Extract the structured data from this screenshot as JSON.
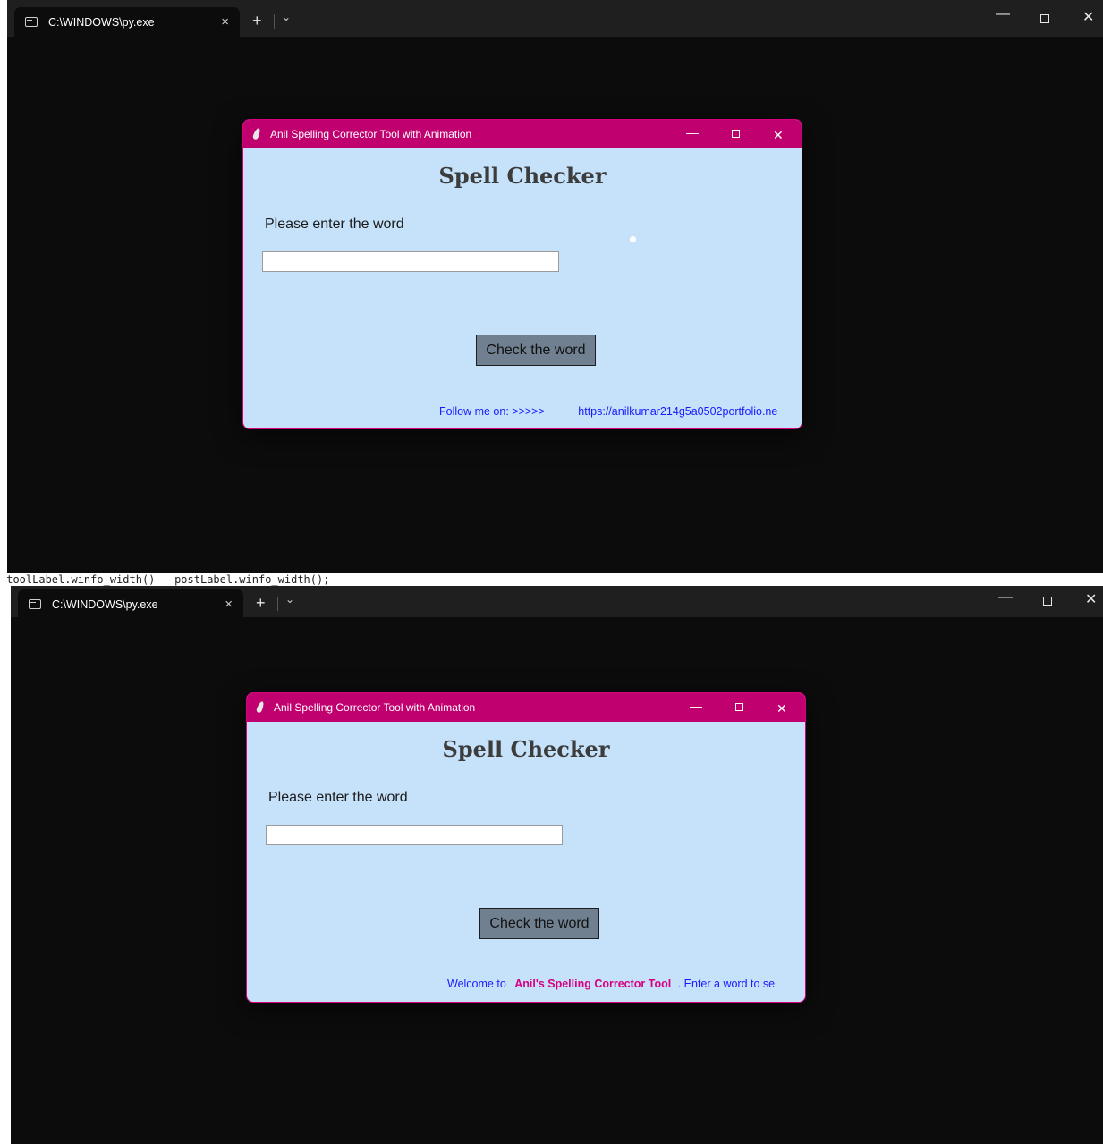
{
  "background": {
    "code_line": "-toolLabel.winfo_width() - postLabel.winfo_width();"
  },
  "terminal": {
    "tab_title": "C:\\WINDOWS\\py.exe",
    "tab_close": "×",
    "new_tab": "+",
    "dropdown": "⌄",
    "minimize": "—",
    "close": "✕"
  },
  "app": {
    "title": "Anil Spelling Corrector Tool with Animation",
    "minimize": "—",
    "close": "✕",
    "heading": "Spell Checker",
    "prompt": "Please enter the word",
    "entry_value": "",
    "button_label": "Check the word",
    "colors": {
      "titlebar": "#c0006f",
      "window_bg": "#c6e2fb",
      "button_bg": "#708090",
      "footer_blue": "#1a1aff",
      "footer_pink": "#d7007f"
    }
  },
  "footer_top": {
    "follow_label": "Follow me on: >>>>>",
    "link": "https://anilkumar214g5a0502portfolio.ne"
  },
  "footer_bottom": {
    "welcome": "Welcome to",
    "app_name": "Anil's Spelling Corrector Tool",
    "rest": ". Enter a word to se"
  }
}
